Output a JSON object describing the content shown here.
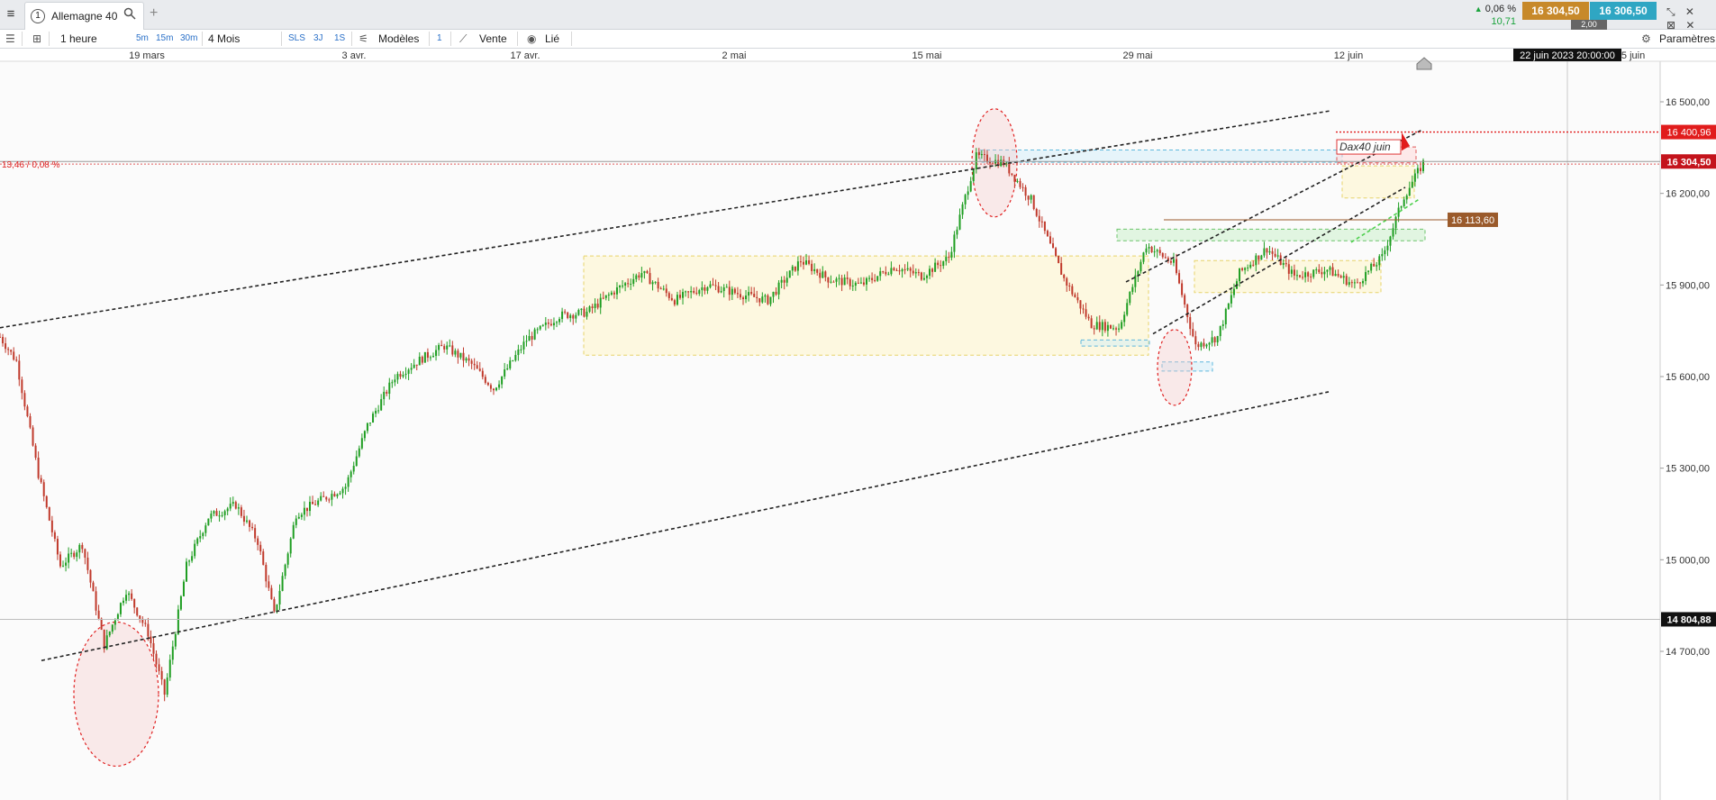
{
  "tabbar": {
    "menu_icon": "≡",
    "tab_number": "1",
    "tab_label": "Allemagne 40",
    "search_icon": "🔍",
    "add_tab": "+",
    "window_icons": "⤡ ✕ ⊠ ✕"
  },
  "quote": {
    "change_pct": "0,06 %",
    "change_pts": "10,71",
    "sell": "16 304,50",
    "buy": "16 306,50",
    "spread": "2,00",
    "up_color": "#1aa33c",
    "sell_color": "#c7892a",
    "buy_color": "#2fa6c3"
  },
  "toolbar": {
    "timeframe": "1 heure",
    "tf_5m": "5m",
    "tf_15m": "15m",
    "tf_30m": "30m",
    "period": "4 Mois",
    "sls": "SLS",
    "three_j": "3J",
    "one_s": "1S",
    "models": "Modèles",
    "one": "1",
    "sell_label": "Vente",
    "linked": "Lié",
    "settings": "Paramètres"
  },
  "chart_data": {
    "type": "candlestick",
    "instrument": "Allemagne 40",
    "x_ticks": [
      "19 mars",
      "3 avr.",
      "17 avr.",
      "2 mai",
      "15 mai",
      "29 mai",
      "12 juin",
      "25 juin"
    ],
    "cursor_date": "22 juin 2023 20:00:00",
    "y_ticks": [
      "16 500,00",
      "16 200,00",
      "15 900,00",
      "15 600,00",
      "15 300,00",
      "15 000,00",
      "14 700,00"
    ],
    "ylim": [
      14500,
      16700
    ],
    "price_tags": {
      "resistance": "16 400,96",
      "last": "16 304,50",
      "support": "16 113,60",
      "cursor": "14 804,88"
    },
    "left_readout": "13,46 / 0,08 %",
    "annotation": "Dax40 juin",
    "colors": {
      "up": "#1f9e22",
      "down": "#c0392b",
      "last": "#c4141c",
      "support": "#9a5a2b",
      "resistance": "#e11c1c"
    }
  }
}
